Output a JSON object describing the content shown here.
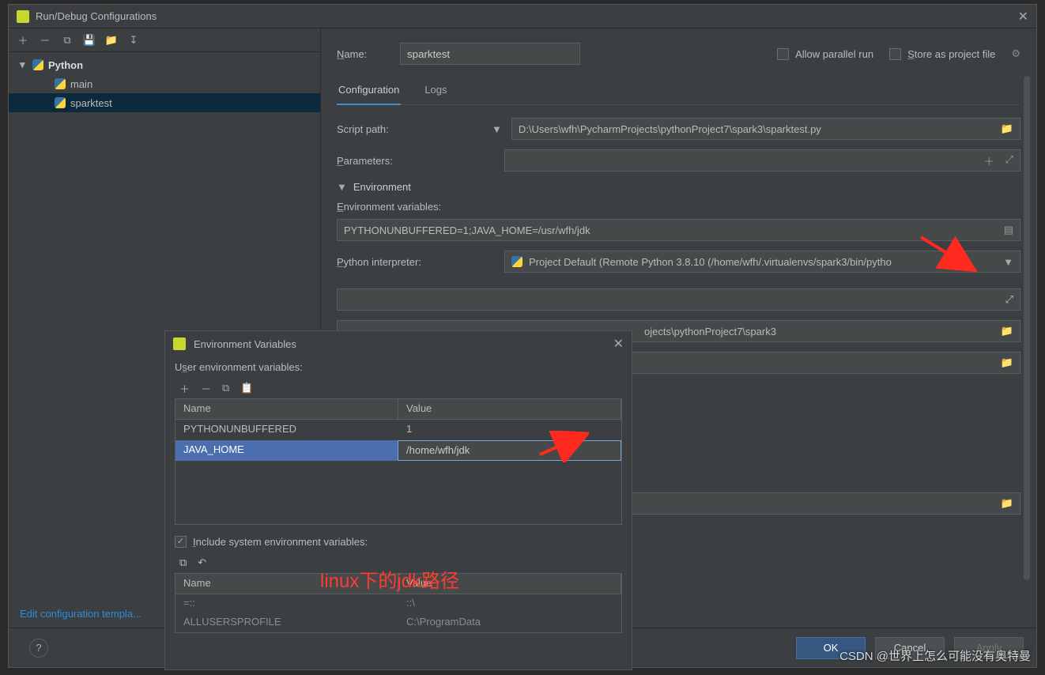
{
  "dialog": {
    "title": "Run/Debug Configurations"
  },
  "tree": {
    "root": "Python",
    "children": [
      "main",
      "sparktest"
    ]
  },
  "editLink": "Edit configuration templa...",
  "form": {
    "nameLabel": "Name:",
    "nameValue": "sparktest",
    "allowParallel": "Allow parallel run",
    "storeAsProject": "Store as project file"
  },
  "tabs": {
    "config": "Configuration",
    "logs": "Logs"
  },
  "fields": {
    "scriptPathLabel": "Script path:",
    "scriptPathValue": "D:\\Users\\wfh\\PycharmProjects\\pythonProject7\\spark3\\sparktest.py",
    "parametersLabel": "Parameters:",
    "envSection": "Environment",
    "envVarsLabel": "Environment variables:",
    "envVarsValue": "PYTHONUNBUFFERED=1;JAVA_HOME=/usr/wfh/jdk",
    "pyInterpLabel": "Python interpreter:",
    "pyInterpValue": "Project Default (Remote Python 3.8.10 (/home/wfh/.virtualenvs/spark3/bin/pytho",
    "workingDirTail": "ojects\\pythonProject7\\spark3"
  },
  "envDialog": {
    "title": "Environment Variables",
    "userLabel": "User environment variables:",
    "headers": {
      "name": "Name",
      "value": "Value"
    },
    "rows": [
      {
        "name": "PYTHONUNBUFFERED",
        "value": "1"
      },
      {
        "name": "JAVA_HOME",
        "value": "/home/wfh/jdk"
      }
    ],
    "includeLabel": "Include system environment variables:",
    "sysRows": [
      {
        "name": "=::",
        "value": "::\\"
      },
      {
        "name": "ALLUSERSPROFILE",
        "value": "C:\\ProgramData"
      }
    ]
  },
  "buttons": {
    "ok": "OK",
    "cancel": "Cancel",
    "apply": "Apply"
  },
  "annotation": "linux下的jdk路径",
  "watermark": "CSDN @世界上怎么可能没有奥特曼"
}
